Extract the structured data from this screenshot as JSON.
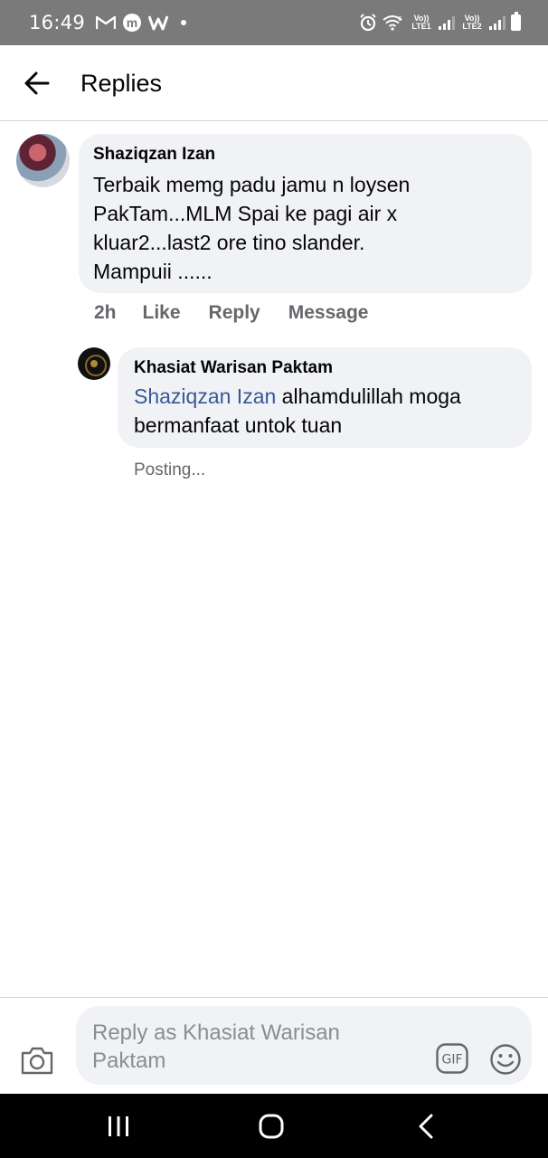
{
  "status_bar": {
    "time": "16:49",
    "left_icons": [
      "gmail-icon",
      "m-circle-icon",
      "w-icon",
      "dot-icon"
    ],
    "right_icons": [
      "alarm-icon",
      "wifi-icon",
      "signal-lte1-icon",
      "signal-lte2-icon",
      "battery-icon"
    ],
    "lte1_label": "Vo)) LTE1",
    "lte2_label": "Vo)) LTE2",
    "wifi_label": "6"
  },
  "header": {
    "title": "Replies",
    "back_icon": "arrow-left-icon"
  },
  "comment": {
    "author": "Shaziqzan Izan",
    "text": "Terbaik memg padu jamu n loysen\nPakTam...MLM Spai ke pagi air x\nkluar2...last2 ore tino slander.\nMampuii ......",
    "time": "2h",
    "like_label": "Like",
    "reply_label": "Reply",
    "message_label": "Message"
  },
  "reply": {
    "author": "Khasiat Warisan Paktam",
    "mention": "Shaziqzan Izan",
    "text": " alhamdulillah moga bermanfaat untok tuan",
    "status": "Posting..."
  },
  "composer": {
    "placeholder": "Reply as Khasiat Warisan Paktam",
    "gif_label": "GIF",
    "camera_icon": "camera-icon",
    "emoji_icon": "smiley-icon"
  },
  "nav": {
    "icons": [
      "recents-icon",
      "home-icon",
      "back-icon"
    ]
  },
  "colors": {
    "status_bar": "#7a7a7a",
    "bubble": "#f0f2f5",
    "mention": "#385898",
    "secondary_text": "#65676b",
    "nav_bar": "#000000"
  }
}
